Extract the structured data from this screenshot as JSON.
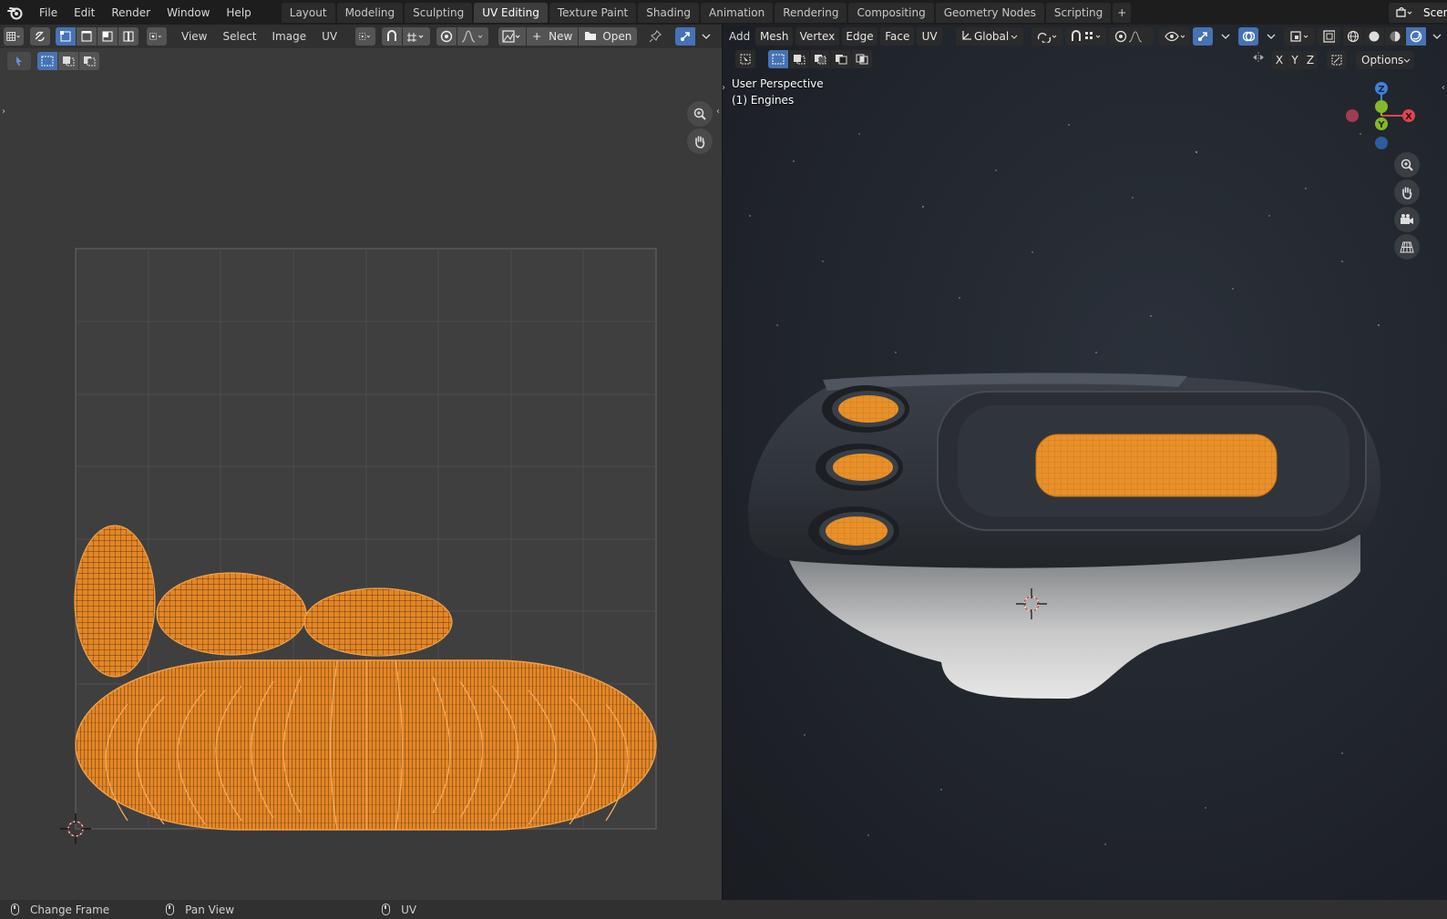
{
  "app": {
    "name": "Blender",
    "logo_icon": "blender-logo-icon"
  },
  "menu": [
    "File",
    "Edit",
    "Render",
    "Window",
    "Help"
  ],
  "workspaces": [
    "Layout",
    "Modeling",
    "Sculpting",
    "UV Editing",
    "Texture Paint",
    "Shading",
    "Animation",
    "Rendering",
    "Compositing",
    "Geometry Nodes",
    "Scripting"
  ],
  "active_workspace": "UV Editing",
  "scene_label": "Scen",
  "uv_editor": {
    "menus": [
      "View",
      "Select",
      "Image",
      "UV"
    ],
    "new_label": "New",
    "open_label": "Open",
    "uv_color": "#f0891f"
  },
  "viewport": {
    "menus": [
      "Add",
      "Mesh",
      "Vertex",
      "Edge",
      "Face",
      "UV"
    ],
    "orientation": "Global",
    "axis_buttons": [
      "X",
      "Y",
      "Z"
    ],
    "options_label": "Options",
    "view_name": "User Perspective",
    "object_name": "(1) Engines",
    "gizmo": {
      "x": "X",
      "y": "Y",
      "z": "Z"
    }
  },
  "status": [
    {
      "icon": "mouse-left-icon",
      "label": "Change Frame"
    },
    {
      "icon": "mouse-middle-icon",
      "label": "Pan View"
    },
    {
      "icon": "mouse-right-icon",
      "label": "UV"
    }
  ],
  "colors": {
    "accent": "#4772b3",
    "uv": "#f0891f",
    "x_axis": "#e04553",
    "y_axis": "#85b82a",
    "z_axis": "#3d83d9"
  }
}
